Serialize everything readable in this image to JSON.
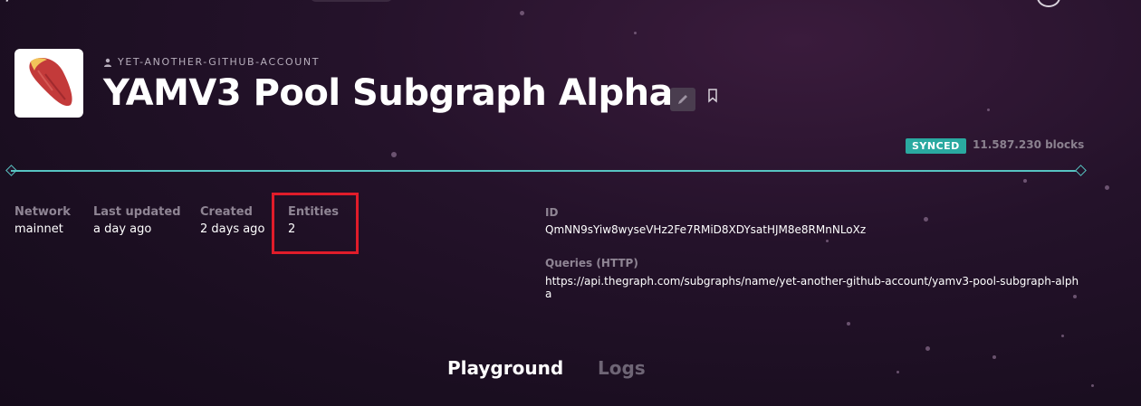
{
  "subgraph": {
    "owner": "YET-ANOTHER-GITHUB-ACCOUNT",
    "title": "YAMV3 Pool Subgraph Alpha"
  },
  "sync": {
    "status": "SYNCED",
    "blocks": "11.587.230 blocks",
    "progress_fraction": 1.0
  },
  "meta": {
    "network": {
      "label": "Network",
      "value": "mainnet"
    },
    "last_updated": {
      "label": "Last updated",
      "value": "a day ago"
    },
    "created": {
      "label": "Created",
      "value": "2 days ago"
    },
    "entities": {
      "label": "Entities",
      "value": "2"
    }
  },
  "details": {
    "id_label": "ID",
    "id_value": "QmNN9sYiw8wyseVHz2Fe7RMiD8XDYsatHJM8e8RMnNLoXz",
    "queries_label": "Queries (HTTP)",
    "queries_value": "https://api.thegraph.com/subgraphs/name/yet-another-github-account/yamv3-pool-subgraph-alpha"
  },
  "tabs": {
    "playground": "Playground",
    "logs": "Logs"
  },
  "colors": {
    "accent_teal": "#57c4c2",
    "badge": "#2aa9a0",
    "highlight": "#e01c2a"
  },
  "icons": {
    "owner": "user-icon",
    "edit": "pencil-icon",
    "bookmark": "bookmark-icon",
    "logo": "sweet-potato-icon"
  }
}
